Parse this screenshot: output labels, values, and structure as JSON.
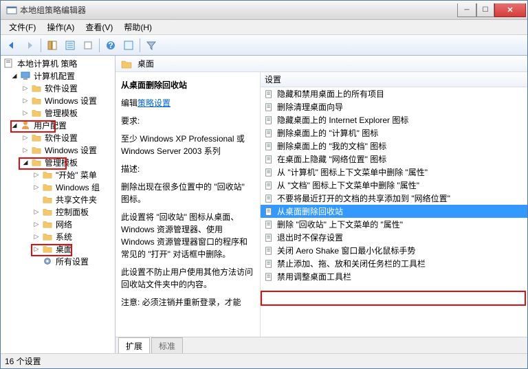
{
  "window": {
    "title": "本地组策略编辑器"
  },
  "menu": {
    "file": "文件(F)",
    "action": "操作(A)",
    "view": "查看(V)",
    "help": "帮助(H)"
  },
  "tree": {
    "root": "本地计算机 策略",
    "computer": "计算机配置",
    "c_soft": "软件设置",
    "c_win": "Windows 设置",
    "c_admin": "管理模板",
    "user": "用户配置",
    "u_soft": "软件设置",
    "u_win": "Windows 设置",
    "u_admin": "管理模板",
    "start": "\"开始\" 菜单",
    "wincomp": "Windows 组",
    "shared": "共享文件夹",
    "ctrlpanel": "控制面板",
    "network": "网络",
    "system": "系统",
    "desktop": "桌面",
    "allset": "所有设置"
  },
  "header": {
    "label": "桌面"
  },
  "desc": {
    "title": "从桌面删除回收站",
    "edit_prefix": "编辑",
    "edit_link": "策略设置",
    "req_label": "要求:",
    "req_text": "至少 Windows XP Professional 或 Windows Server 2003 系列",
    "desc_label": "描述:",
    "desc1": "删除出现在很多位置中的 \"回收站\" 图标。",
    "desc2": "此设置将 \"回收站\" 图标从桌面、Windows 资源管理器、使用 Windows 资源管理器窗口的程序和常见的 \"打开\" 对话框中删除。",
    "desc3": "此设置不防止用户使用其他方法访问回收站文件夹中的内容。",
    "desc4": "注意: 必须注销并重新登录，才能"
  },
  "listhead": "设置",
  "list": [
    "隐藏和禁用桌面上的所有项目",
    "删除清理桌面向导",
    "隐藏桌面上的 Internet Explorer 图标",
    "删除桌面上的 \"计算机\" 图标",
    "删除桌面上的 \"我的文档\" 图标",
    "在桌面上隐藏 \"网络位置\" 图标",
    "从 \"计算机\" 图标上下文菜单中删除 \"属性\"",
    "从 \"文档\" 图标上下文菜单中删除 \"属性\"",
    "不要将最近打开的文档的共享添加到 \"网络位置\"",
    "从桌面删除回收站",
    "删除 \"回收站\" 上下文菜单的 \"属性\"",
    "退出时不保存设置",
    "关闭 Aero Shake 窗口最小化鼠标手势",
    "禁止添加、拖、放和关闭任务栏的工具栏",
    "禁用调整桌面工具栏"
  ],
  "tabs": {
    "ext": "扩展",
    "std": "标准"
  },
  "status": "16 个设置"
}
